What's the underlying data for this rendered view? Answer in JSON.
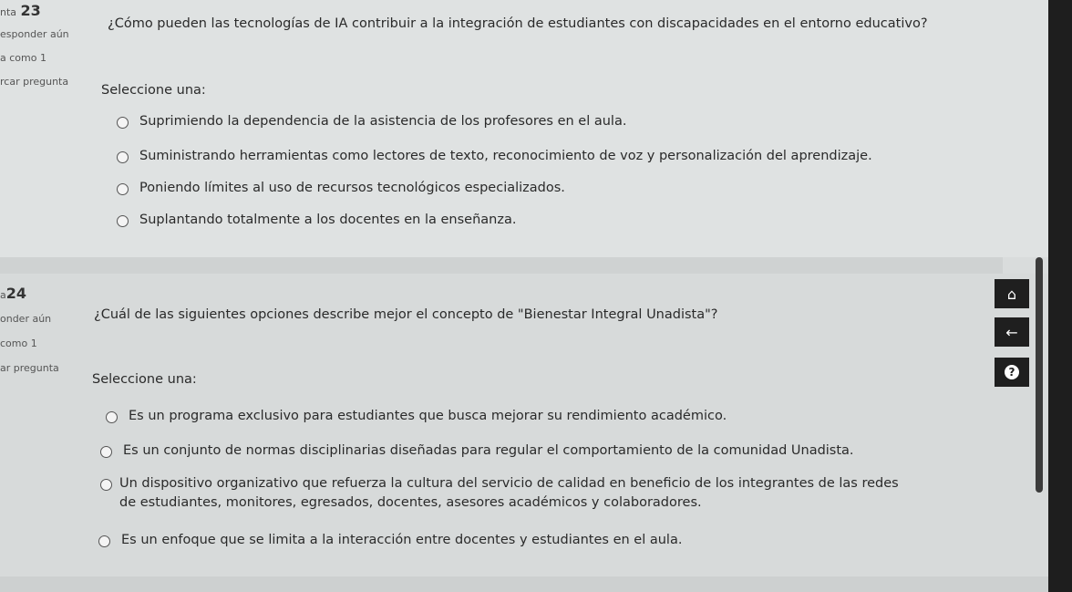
{
  "questions": [
    {
      "number_prefix": "nta",
      "number": "23",
      "status": "esponder aún",
      "marks": "a como 1",
      "flag": "rcar pregunta",
      "text": "¿Cómo pueden las tecnologías de IA contribuir a la integración de estudiantes con discapacidades en el entorno educativo?",
      "prompt": "Seleccione una:",
      "options": [
        "Suprimiendo la dependencia de la asistencia de los profesores en el aula.",
        "Suministrando herramientas como lectores de texto, reconocimiento de voz y personalización del aprendizaje.",
        "Poniendo límites al uso de recursos tecnológicos especializados.",
        "Suplantando totalmente a los docentes en la enseñanza."
      ]
    },
    {
      "number_prefix": "a",
      "number": "24",
      "status": "onder aún",
      "marks": "como 1",
      "flag": "ar pregunta",
      "text": "¿Cuál de las siguientes opciones describe mejor el concepto de \"Bienestar Integral Unadista\"?",
      "prompt": "Seleccione una:",
      "options": [
        "Es un programa exclusivo para estudiantes que busca mejorar su rendimiento académico.",
        "Es un conjunto de normas disciplinarias diseñadas para regular el comportamiento de la comunidad Unadista.",
        "Un dispositivo organizativo que refuerza la cultura del servicio de calidad en beneficio de los integrantes de las redes de estudiantes, monitores, egresados, docentes, asesores académicos y colaboradores.",
        "Es un enfoque que se limita a la interacción entre docentes y estudiantes en el aula."
      ]
    }
  ],
  "nav": {
    "home_icon": "⌂",
    "back_icon": "←",
    "help_icon": "?"
  },
  "icons": [
    "home-icon",
    "back-arrow-icon",
    "help-icon"
  ],
  "colors": {
    "background": "#dfe2e2",
    "scrollbar": "#1e1e1e",
    "nav_button": "#1f1f1f"
  }
}
